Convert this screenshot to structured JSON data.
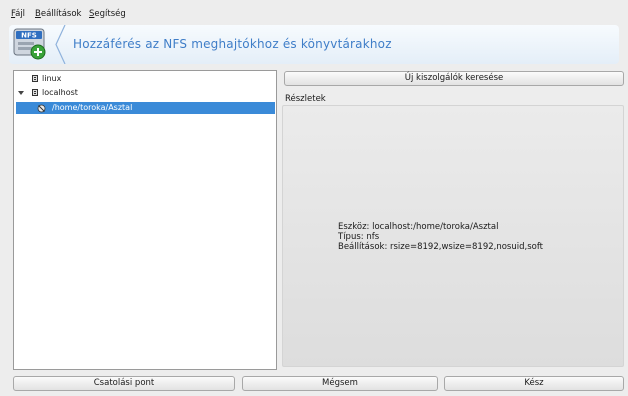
{
  "menubar": {
    "file": {
      "accel": "F",
      "rest": "ájl"
    },
    "settings": {
      "accel": "B",
      "rest": "eállítások"
    },
    "help": {
      "accel": "S",
      "rest": "egítség"
    }
  },
  "banner": {
    "icon_name": "nfs-mount-icon",
    "icon_text": "NFS",
    "title": "Hozzáférés az NFS meghajtókhoz és könyvtárakhoz"
  },
  "tree": {
    "items": [
      {
        "label": "linux",
        "icon": "server-icon",
        "expanded": false
      },
      {
        "label": "localhost",
        "icon": "server-icon",
        "expanded": true
      },
      {
        "label": "/home/toroka/Asztal",
        "icon": "folder-share-icon",
        "selected": true
      }
    ]
  },
  "buttons": {
    "search_servers": "Új kiszolgálók keresése",
    "mount_point": "Csatolási pont",
    "cancel": "Mégsem",
    "done": "Kész"
  },
  "details": {
    "heading": "Részletek",
    "device": "Eszköz: localhost:/home/toroka/Asztal",
    "type": "Típus: nfs",
    "options": "Beállítások: rsize=8192,wsize=8192,nosuid,soft"
  },
  "colors": {
    "selection": "#3a8ad8",
    "banner_title": "#3f7ec8"
  }
}
